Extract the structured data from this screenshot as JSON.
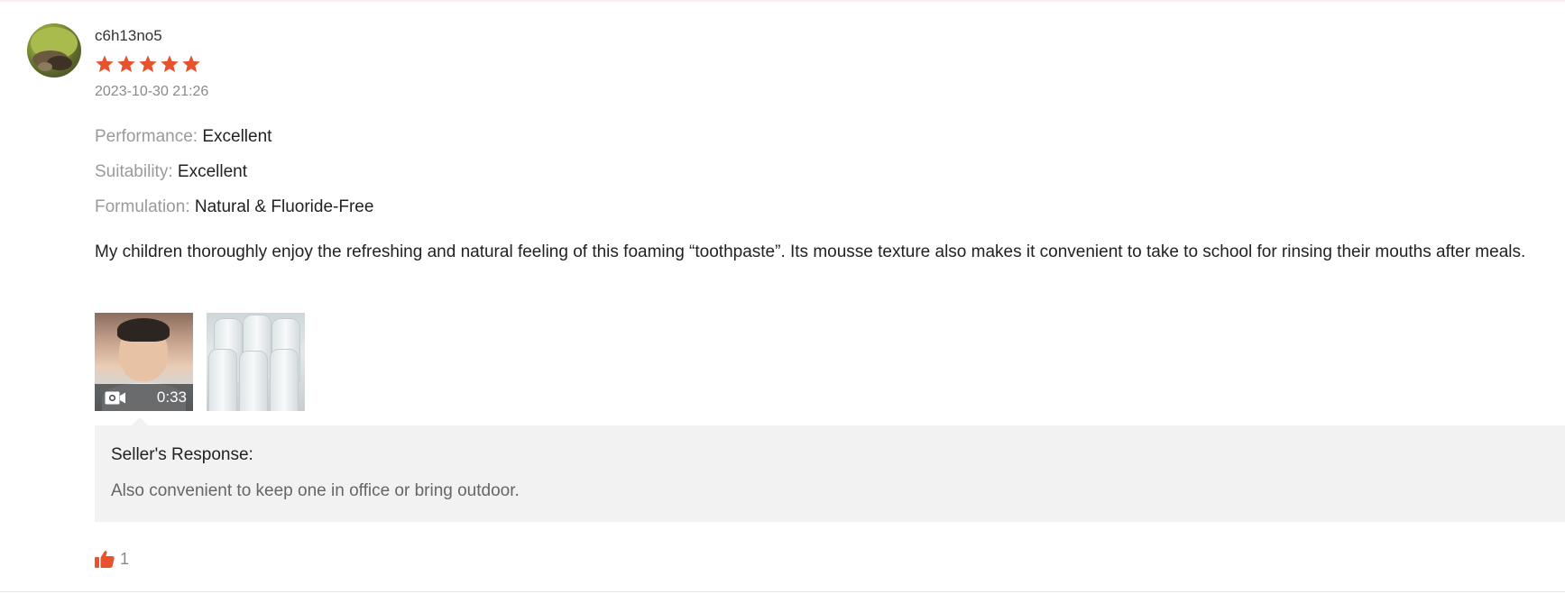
{
  "review": {
    "username": "c6h13no5",
    "rating": 5,
    "rating_max": 5,
    "timestamp": "2023-10-30 21:26",
    "attributes": [
      {
        "key": "Performance:",
        "value": "Excellent"
      },
      {
        "key": "Suitability:",
        "value": "Excellent"
      },
      {
        "key": "Formulation:",
        "value": "Natural & Fluoride-Free"
      }
    ],
    "text": "My children thoroughly enjoy the refreshing and natural feeling of this foaming “toothpaste”. Its mousse texture also makes it convenient to take to school for rinsing their mouths after meals.",
    "media": {
      "video_duration": "0:33"
    },
    "seller_response": {
      "title": "Seller's Response:",
      "text": "Also convenient to keep one in office or bring outdoor."
    },
    "likes": "1"
  },
  "colors": {
    "accent": "#e8522f",
    "muted_text": "#9a9a9a",
    "response_bg": "#f2f2f2"
  },
  "icons": {
    "star": "star-icon",
    "video": "video-camera-icon",
    "like": "thumbs-up-icon"
  }
}
